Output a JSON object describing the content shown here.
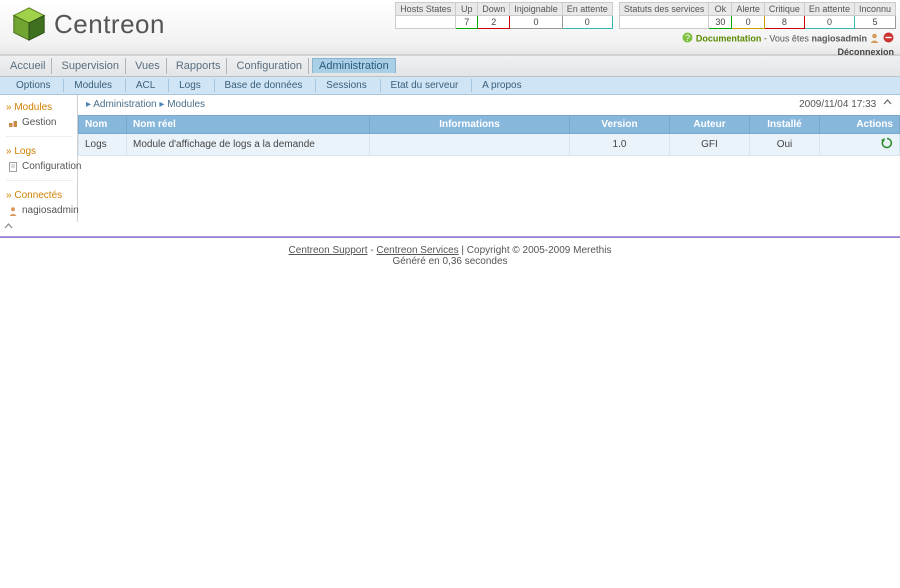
{
  "brand": "Centreon",
  "host_states": {
    "title": "Hosts States",
    "cols": [
      "Up",
      "Down",
      "Injoignable",
      "En attente"
    ],
    "vals": [
      "7",
      "2",
      "0",
      "0"
    ],
    "colors": [
      "#0a0",
      "#c00",
      "#999",
      "#3bb5b0"
    ]
  },
  "service_states": {
    "title": "Statuts des services",
    "cols": [
      "Ok",
      "Alerte",
      "Critique",
      "En attente",
      "Inconnu"
    ],
    "vals": [
      "30",
      "0",
      "8",
      "0",
      "5"
    ],
    "colors": [
      "#0a0",
      "#caa200",
      "#c00",
      "#3bb5b0",
      "#999"
    ]
  },
  "userline": {
    "doc": "Documentation",
    "youare": "Vous êtes",
    "user": "nagiosadmin",
    "logout": "Déconnexion"
  },
  "nav": [
    "Accueil",
    "Supervision",
    "Vues",
    "Rapports",
    "Configuration",
    "Administration"
  ],
  "nav_active_index": 5,
  "subnav": [
    "Options",
    "Modules",
    "ACL",
    "Logs",
    "Base de données",
    "Sessions",
    "Etat du serveur",
    "A propos"
  ],
  "sidebar": {
    "group1": {
      "title": "Modules",
      "items": [
        "Gestion"
      ]
    },
    "group2": {
      "title": "Logs",
      "items": [
        "Configuration"
      ]
    },
    "group3": {
      "title": "Connectés",
      "items": [
        "nagiosadmin"
      ]
    }
  },
  "crumb": {
    "a": "Administration",
    "b": "Modules"
  },
  "timestamp": "2009/11/04 17:33",
  "table": {
    "headers": [
      "Nom",
      "Nom réel",
      "Informations",
      "Version",
      "Auteur",
      "Installé",
      "Actions"
    ],
    "row": {
      "nom": "Logs",
      "nomreel": "Module d'affichage de logs a la demande",
      "info": "",
      "version": "1.0",
      "auteur": "GFI",
      "installe": "Oui"
    }
  },
  "footer": {
    "support": "Centreon Support",
    "services": "Centreon Services",
    "copyright": "| Copyright © 2005-2009 Merethis",
    "gen": "Généré en 0,36 secondes"
  }
}
